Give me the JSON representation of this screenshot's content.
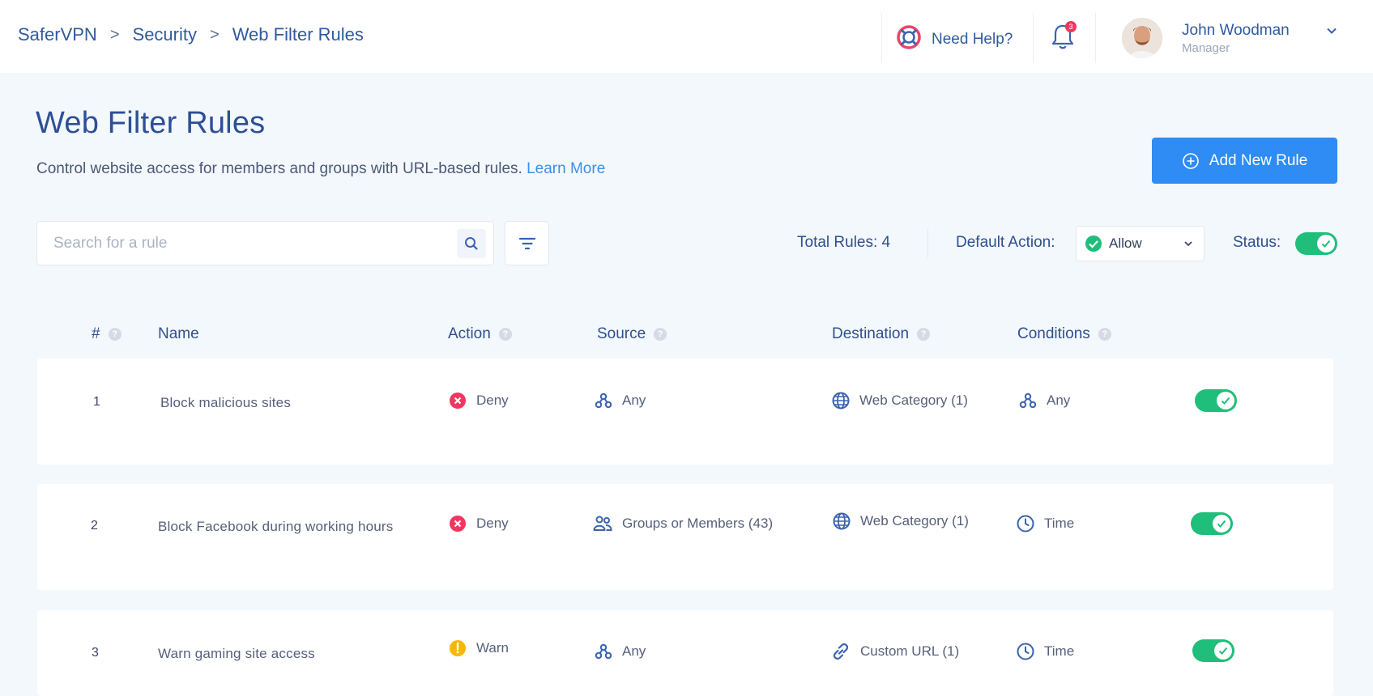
{
  "breadcrumb": [
    "SaferVPN",
    "Security",
    "Web Filter Rules"
  ],
  "topbar": {
    "help_label": "Need Help?",
    "notification_count": "3",
    "user_name": "John Woodman",
    "user_role": "Manager"
  },
  "page": {
    "title": "Web Filter Rules",
    "description": "Control website access for members and groups with URL-based rules.",
    "learn_more": "Learn More",
    "add_button": "Add New Rule"
  },
  "toolbar": {
    "search_placeholder": "Search for a rule",
    "total_rules": "Total Rules: 4",
    "default_action_label": "Default Action:",
    "default_action_value": "Allow",
    "status_label": "Status:",
    "status_on": true
  },
  "table": {
    "columns": [
      "#",
      "Name",
      "Action",
      "Source",
      "Destination",
      "Conditions"
    ],
    "rows": [
      {
        "num": "1",
        "name": "Block malicious sites",
        "action": "Deny",
        "action_type": "deny",
        "source": "Any",
        "source_icon": "any-icon",
        "destination": "Web Category (1)",
        "dest_icon": "globe-icon",
        "condition": "Any",
        "cond_icon": "any-icon",
        "enabled": true
      },
      {
        "num": "2",
        "name": "Block Facebook during working hours",
        "action": "Deny",
        "action_type": "deny",
        "source": "Groups or Members (43)",
        "source_icon": "users-icon",
        "destination": "Web Category (1)",
        "dest_icon": "globe-icon",
        "condition": "Time",
        "cond_icon": "clock-icon",
        "enabled": true
      },
      {
        "num": "3",
        "name": "Warn gaming site access",
        "action": "Warn",
        "action_type": "warn",
        "source": "Any",
        "source_icon": "any-icon",
        "destination": "Custom URL (1)",
        "dest_icon": "link-icon",
        "condition": "Time",
        "cond_icon": "clock-icon",
        "enabled": true
      }
    ]
  },
  "colors": {
    "accent": "#2e8cf4",
    "toggle_on": "#1fbe7a",
    "deny": "#f0375f",
    "warn": "#f5b800",
    "heading": "#2d4f95"
  }
}
